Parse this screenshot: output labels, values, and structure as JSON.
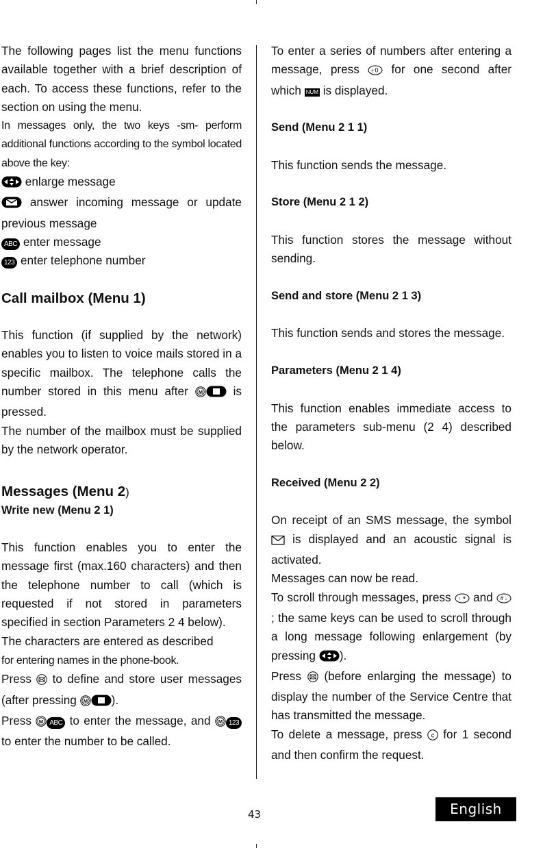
{
  "page": {
    "number": "43",
    "language_tab": "English"
  },
  "left": {
    "intro": "The following pages list the menu functions available together with a brief description of each. To access these functions, refer to the section on using the menu.",
    "keys_intro": "In messages only, the two keys -sm- perform additional functions according to the symbol located above the key:",
    "symbols": [
      {
        "icon": "enlarge-icon",
        "text": "enlarge message"
      },
      {
        "icon": "envelope-key-icon",
        "text": "answer incoming message or update previous message"
      },
      {
        "icon": "abc-key-icon",
        "text": "enter message",
        "glyph": "ABC"
      },
      {
        "icon": "123-key-icon",
        "text": "enter telephone number",
        "glyph": "123"
      }
    ],
    "call_mailbox": {
      "heading": "Call mailbox (Menu 1)",
      "p1": "This function (if supplied by the network) enables you to listen to voice mails stored in a specific mailbox. The telephone calls the number stored in this menu after",
      "p1_end": "is pressed.",
      "p2": "The number of the mailbox must be supplied by the network operator."
    },
    "messages": {
      "heading": "Messages (Menu 2",
      "heading_close": ")",
      "write_new_heading": "Write new  (Menu 2 1)",
      "p1": "This function enables you to enter the message first (max.160 characters) and then the telephone number to call (which is requested if not stored in parameters specified in section Parameters 2 4 below).",
      "p2a": "The characters are entered as described",
      "p2b": "for entering names in the phone-book.",
      "p3_start": "Press",
      "p3_mid": "to define and store user messages (after pressing",
      "p3_end": ").",
      "p4_start": "Press",
      "p4_mid": "to enter the message, and",
      "p4_end": "to enter the number to be called.",
      "m_glyph": "M",
      "abc_glyph": "ABC",
      "num_glyph": "123"
    }
  },
  "right": {
    "intro_a": "To enter a series of numbers after entering a message, press",
    "intro_b": "for one second after which",
    "intro_c": "is displayed.",
    "num_indicator": "NUM",
    "zero_key": "+0",
    "sections": [
      {
        "heading": "Send  (Menu 2 1 1)",
        "text": "This function sends the message."
      },
      {
        "heading": "Store  (Menu 2 1 2)",
        "text": "This function stores the message without sending."
      },
      {
        "heading": "Send and store  (Menu 2 1 3)",
        "text": "This function sends and stores the message."
      },
      {
        "heading": "Parameters  (Menu 2 1 4)",
        "text": "This function enables immediate access to the parameters sub-menu (2 4) described below."
      }
    ],
    "received": {
      "heading": "Received  (Menu 2 2)",
      "p1_a": "On receipt of an SMS message, the symbol",
      "p1_b": "is displayed and an acoustic signal is activated.",
      "p2": "Messages can now be read.",
      "p3_a": "To scroll through messages, press",
      "p3_b": "and",
      "p3_c": "; the same keys can be used to scroll through a long message following enlargement (by pressing",
      "p3_d": ").",
      "p4_a": "Press",
      "p4_b": "(before enlarging the message) to display the number of the Service Centre that has transmitted the message.",
      "p5_a": "To delete a message, press",
      "p5_b": "for 1 second and then confirm the request.",
      "star_key": "↑*",
      "hash_key": "#↓",
      "c_key": "c"
    }
  }
}
